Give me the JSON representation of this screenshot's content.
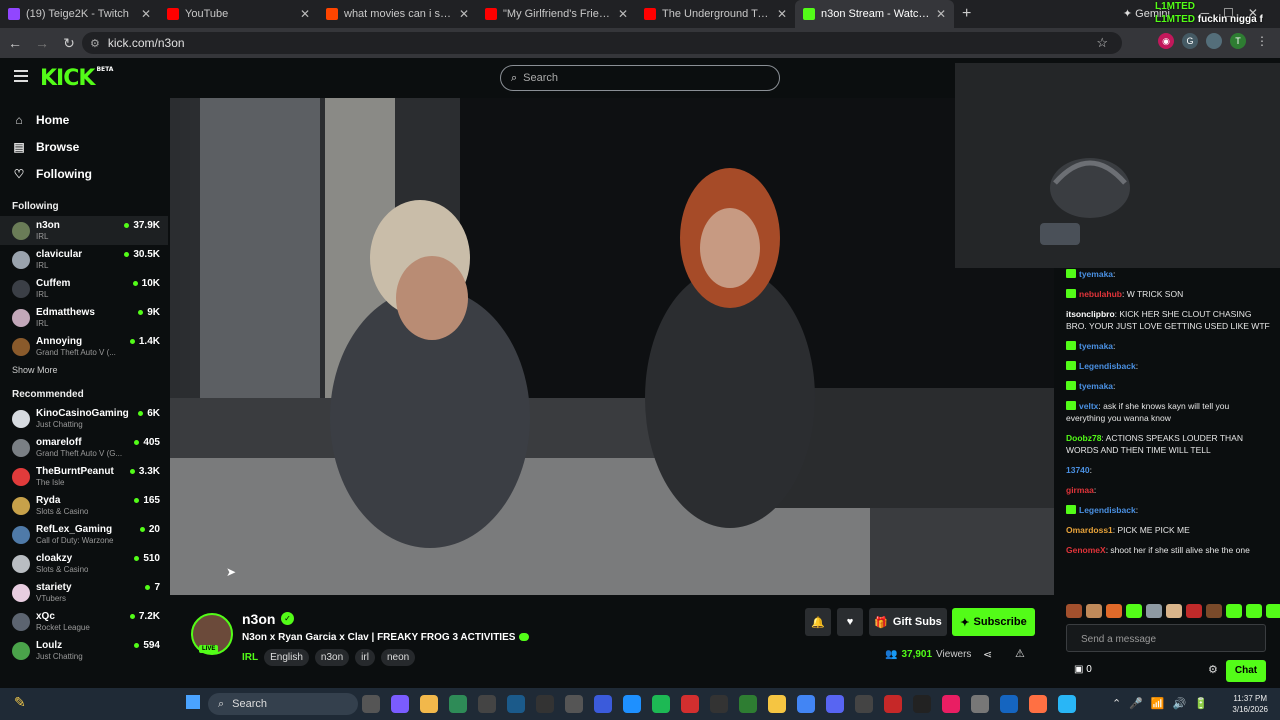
{
  "browser": {
    "tabs": [
      {
        "title": "(19) Teige2K - Twitch",
        "icon": "twitch-icon",
        "color": "#9146ff"
      },
      {
        "title": "YouTube",
        "icon": "youtube-icon",
        "color": "#ff0000"
      },
      {
        "title": "what movies can i stream : r/Ki",
        "icon": "reddit-icon",
        "color": "#ff4500"
      },
      {
        "title": "\"My Girlfriend's Friend's Lips A",
        "icon": "youtube-icon",
        "color": "#ff0000"
      },
      {
        "title": "The Underground Tunnel Peopl",
        "icon": "youtube-icon",
        "color": "#ff0000"
      },
      {
        "title": "n3on Stream - Watch Live o",
        "icon": "kick-icon",
        "color": "#53fc18"
      }
    ],
    "gemini_label": "Gemini",
    "url": "kick.com/n3on"
  },
  "kick": {
    "logo": "KICK",
    "logo_beta": "BETA",
    "search_placeholder": "Search",
    "nav": [
      {
        "label": "Home",
        "icon": "home-icon"
      },
      {
        "label": "Browse",
        "icon": "browse-icon"
      },
      {
        "label": "Following",
        "icon": "heart-icon"
      }
    ],
    "following_heading": "Following",
    "following": [
      {
        "name": "n3on",
        "category": "IRL",
        "viewers": "37.9K",
        "color": "#6a7c57"
      },
      {
        "name": "clavicular",
        "category": "IRL",
        "viewers": "30.5K",
        "color": "#9aa3ad"
      },
      {
        "name": "Cuffem",
        "category": "IRL",
        "viewers": "10K",
        "color": "#3b3f46"
      },
      {
        "name": "Edmatthews",
        "category": "IRL",
        "viewers": "9K",
        "color": "#c2a7b9"
      },
      {
        "name": "Annoying",
        "category": "Grand Theft Auto V (...",
        "viewers": "1.4K",
        "color": "#8a5a2b"
      }
    ],
    "show_more": "Show More",
    "recommended_heading": "Recommended",
    "recommended": [
      {
        "name": "KinoCasinoGaming",
        "category": "Just Chatting",
        "viewers": "6K",
        "color": "#d7dbe0"
      },
      {
        "name": "omareloff",
        "category": "Grand Theft Auto V (G...",
        "viewers": "405",
        "color": "#7a7f84"
      },
      {
        "name": "TheBurntPeanut",
        "category": "The Isle",
        "viewers": "3.3K",
        "color": "#e13b3b"
      },
      {
        "name": "Ryda",
        "category": "Slots & Casino",
        "viewers": "165",
        "color": "#c7a14a"
      },
      {
        "name": "RefLex_Gaming",
        "category": "Call of Duty: Warzone",
        "viewers": "20",
        "color": "#4f7aa8"
      },
      {
        "name": "cloakzy",
        "category": "Slots & Casino",
        "viewers": "510",
        "color": "#b9bdc2"
      },
      {
        "name": "stariety",
        "category": "VTubers",
        "viewers": "7",
        "color": "#e8cde0"
      },
      {
        "name": "xQc",
        "category": "Rocket League",
        "viewers": "7.2K",
        "color": "#5c6470"
      },
      {
        "name": "Loulz",
        "category": "Just Chatting",
        "viewers": "594",
        "color": "#4aa34a"
      }
    ],
    "stream": {
      "name": "n3on",
      "live": "LIVE",
      "title": "N3on x Ryan Garcia x Clav | FREAKY FROG 3 ACTIVITIES",
      "category": "IRL",
      "tags": [
        "English",
        "n3on",
        "irl",
        "neon"
      ],
      "gift_subs": "Gift Subs",
      "subscribe": "Subscribe",
      "viewers": "37,901",
      "viewers_label": "Viewers"
    },
    "overlay": {
      "line1": "L1MTED",
      "line2": "L1MTED",
      "line2b": "fuckin nigga f"
    },
    "chat": {
      "messages": [
        {
          "user": "tyemaka",
          "text": ":",
          "color": "#4a90e2",
          "badge": true
        },
        {
          "user": "nebulahub",
          "text": ": W TRICK SON",
          "color": "#e0343a",
          "badge": true
        },
        {
          "user": "itsonclipbro",
          "text": ": KICK HER SHE CLOUT CHASING BRO. YOUR JUST LOVE GETTING USED LIKE WTF",
          "color": "#ffffff",
          "badge": false
        },
        {
          "user": "tyemaka",
          "text": ":",
          "color": "#4a90e2",
          "badge": true
        },
        {
          "user": "Legendisback",
          "text": ":",
          "color": "#4a90e2",
          "badge": true
        },
        {
          "user": "tyemaka",
          "text": ":",
          "color": "#4a90e2",
          "badge": true
        },
        {
          "user": "veltx",
          "text": ": ask if she knows kayn will tell you everything you wanna know",
          "color": "#4a90e2",
          "badge": true
        },
        {
          "user": "Doobz78",
          "text": ": ACTIONS SPEAKS LOUDER THAN WORDS AND THEN TIME WILL TELL",
          "color": "#53fc18",
          "badge": false
        },
        {
          "user": "13740",
          "text": ":",
          "color": "#4a90e2",
          "badge": false
        },
        {
          "user": "girmaa",
          "text": ":",
          "color": "#e0343a",
          "badge": false
        },
        {
          "user": "Legendisback",
          "text": ":",
          "color": "#4a90e2",
          "badge": true
        },
        {
          "user": "Omardoss1",
          "text": ": PICK ME PICK ME",
          "color": "#e8a33a",
          "badge": false
        },
        {
          "user": "GenomeX",
          "text": ": shoot her if she still alive she the one",
          "color": "#e0343a",
          "badge": false
        }
      ],
      "send_placeholder": "Send a message",
      "points": "0",
      "chat_button": "Chat"
    }
  },
  "taskbar": {
    "search": "Search",
    "time": "11:37 PM",
    "date": "3/16/2026"
  }
}
